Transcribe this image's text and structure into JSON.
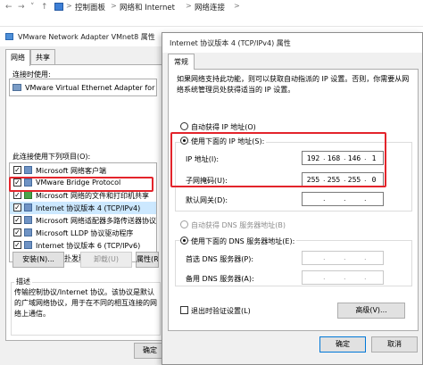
{
  "explorer": {
    "breadcrumbs": [
      "控制面板",
      "网络和 Internet",
      "网络连接"
    ],
    "separator": ">"
  },
  "back_dialog": {
    "title": "VMware Network Adapter VMnet8 属性",
    "tabs": [
      "网络",
      "共享"
    ],
    "connect_using_label": "连接时使用:",
    "adapter_name": "VMware Virtual Ethernet Adapter for V",
    "items_label": "此连接使用下列项目(O):",
    "items": [
      {
        "label": "Microsoft 网络客户端",
        "checked": true,
        "icon": "network-client-icon"
      },
      {
        "label": "VMware Bridge Protocol",
        "checked": true,
        "icon": "protocol-icon"
      },
      {
        "label": "Microsoft 网络的文件和打印机共享",
        "checked": true,
        "icon": "file-share-icon"
      },
      {
        "label": "Internet 协议版本 4 (TCP/IPv4)",
        "checked": true,
        "icon": "protocol-icon"
      },
      {
        "label": "Microsoft 网络适配器多路传送器协议",
        "checked": true,
        "icon": "protocol-icon"
      },
      {
        "label": "Microsoft LLDP 协议驱动程序",
        "checked": true,
        "icon": "protocol-icon"
      },
      {
        "label": "Internet 协议版本 6 (TCP/IPv6)",
        "checked": true,
        "icon": "protocol-icon"
      },
      {
        "label": "链路层拓扑发现响应程序",
        "checked": true,
        "icon": "protocol-icon"
      }
    ],
    "install_button": "安装(N)...",
    "uninstall_button": "卸载(U)",
    "properties_button": "属性(R)",
    "description_title": "描述",
    "description_text": "传输控制协议/Internet 协议。该协议是默认的广域网络协议，用于在不同的相互连接的网络上通信。",
    "ok_button": "确定",
    "cancel_button": "取"
  },
  "front_dialog": {
    "title": "Internet 协议版本 4 (TCP/IPv4) 属性",
    "tab": "常规",
    "intro": "如果网络支持此功能，则可以获取自动指派的 IP 设置。否则，你需要从网络系统管理员处获得适当的 IP 设置。",
    "auto_ip_label": "自动获得 IP 地址(O)",
    "manual_ip_label": "使用下面的 IP 地址(S):",
    "ip_label": "IP 地址(I):",
    "ip_value": [
      "192",
      "168",
      "146",
      "1"
    ],
    "mask_label": "子网掩码(U):",
    "mask_value": [
      "255",
      "255",
      "255",
      "0"
    ],
    "gateway_label": "默认网关(D):",
    "gateway_value": [
      "",
      "",
      "",
      ""
    ],
    "auto_dns_label": "自动获得 DNS 服务器地址(B)",
    "manual_dns_label": "使用下面的 DNS 服务器地址(E):",
    "preferred_dns_label": "首选 DNS 服务器(P):",
    "preferred_dns_value": [
      "",
      "",
      "",
      ""
    ],
    "alternate_dns_label": "备用 DNS 服务器(A):",
    "alternate_dns_value": [
      "",
      "",
      "",
      ""
    ],
    "validate_label": "退出时验证设置(L)",
    "advanced_button": "高级(V)...",
    "ok_button": "确定",
    "cancel_button": "取消"
  },
  "colors": {
    "highlight_red": "#e3242b",
    "dialog_bg": "#f0f0f0",
    "selection_blue": "#cce8ff"
  }
}
